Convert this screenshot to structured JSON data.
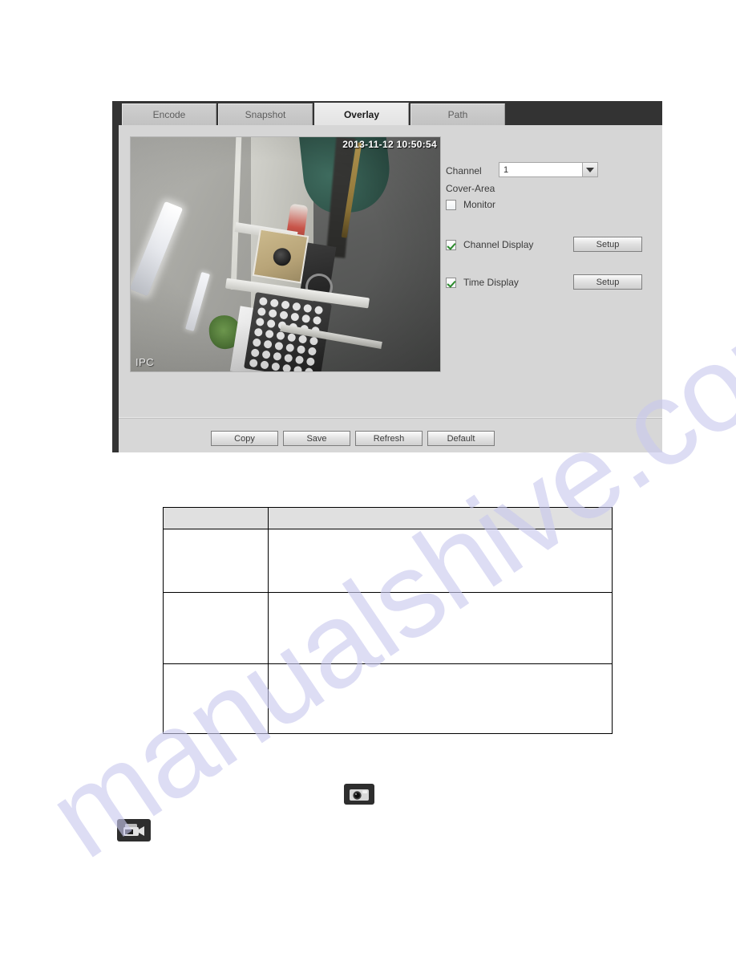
{
  "window": {
    "tabs": [
      {
        "id": "encode",
        "label": "Encode",
        "active": false
      },
      {
        "id": "snapshot",
        "label": "Snapshot",
        "active": false
      },
      {
        "id": "overlay",
        "label": "Overlay",
        "active": true
      },
      {
        "id": "path",
        "label": "Path",
        "active": false
      }
    ]
  },
  "video": {
    "timestamp_osd": "2013-11-12 10:50:54",
    "channel_name_osd": "IPC"
  },
  "controls": {
    "channel_label": "Channel",
    "channel_value": "1",
    "channel_options": [
      "1"
    ],
    "cover_area_label": "Cover-Area",
    "monitor_label": "Monitor",
    "monitor_checked": false,
    "channel_display_label": "Channel Display",
    "channel_display_checked": true,
    "time_display_label": "Time Display",
    "time_display_checked": true,
    "setup_label": "Setup"
  },
  "footer": {
    "copy_label": "Copy",
    "save_label": "Save",
    "refresh_label": "Refresh",
    "default_label": "Default"
  },
  "spec_table": {
    "headers": [
      "",
      ""
    ],
    "rows": [
      {
        "parameter": "",
        "function": ""
      },
      {
        "parameter": "",
        "function": ""
      },
      {
        "parameter": "",
        "function": ""
      }
    ]
  },
  "icons": {
    "snapshot_icon": "camera-icon",
    "record_icon": "video-camera-icon"
  },
  "watermark": {
    "text": "manualshive.com"
  },
  "colors": {
    "tab_strip_bg": "#333333",
    "panel_bg": "#d6d6d6",
    "checkbox_check": "#2a8a2a",
    "watermark": "#c9c9ee",
    "table_border": "#000000",
    "table_header_bg": "#e0e0e0"
  }
}
